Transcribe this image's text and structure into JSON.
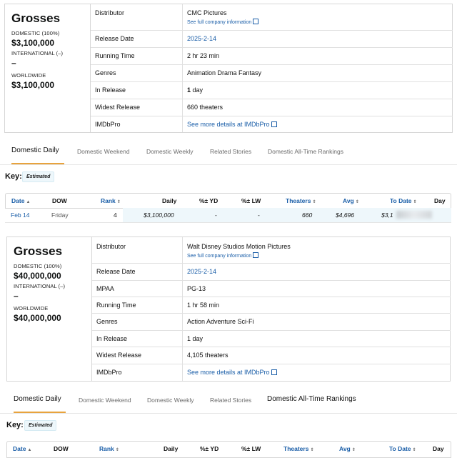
{
  "panel1": {
    "grosses": {
      "title": "Grosses",
      "domestic_label": "DOMESTIC (100%)",
      "domestic_value": "$3,100,000",
      "international_label": "INTERNATIONAL (–)",
      "international_value": "–",
      "worldwide_label": "WORLDWIDE",
      "worldwide_value": "$3,100,000"
    },
    "details": [
      {
        "label": "Distributor",
        "value": "CMC Pictures",
        "sub": "See full company information"
      },
      {
        "label": "Release Date",
        "value": "2025-2-14",
        "link": true
      },
      {
        "label": "Running Time",
        "value": "2 hr 23 min"
      },
      {
        "label": "Genres",
        "value": "Animation Drama Fantasy"
      },
      {
        "label": "In Release",
        "value_bold": "1",
        "value": " day"
      },
      {
        "label": "Widest Release",
        "value": "660 theaters"
      },
      {
        "label": "IMDbPro",
        "value": "See more details at IMDbPro",
        "link": true
      }
    ],
    "tabs": [
      "Domestic Daily",
      "Domestic Weekend",
      "Domestic Weekly",
      "Related Stories",
      "Domestic All-Time Rankings"
    ],
    "key_label": "Key:",
    "key_badge": "Estimated",
    "columns": [
      "Date",
      "DOW",
      "Rank",
      "Daily",
      "%± YD",
      "%± LW",
      "Theaters",
      "Avg",
      "To Date",
      "Day"
    ],
    "row": {
      "date": "Feb 14",
      "dow": "Friday",
      "rank": "4",
      "daily": "$3,100,000",
      "yd": "-",
      "lw": "-",
      "theaters": "660",
      "avg": "$4,696",
      "to_date": "$3,1"
    }
  },
  "panel2": {
    "grosses": {
      "title": "Grosses",
      "domestic_label": "DOMESTIC (100%)",
      "domestic_value": "$40,000,000",
      "international_label": "INTERNATIONAL (–)",
      "international_value": "–",
      "worldwide_label": "WORLDWIDE",
      "worldwide_value": "$40,000,000"
    },
    "details": [
      {
        "label": "Distributor",
        "value": "Walt Disney Studios Motion Pictures",
        "sub": "See full company information"
      },
      {
        "label": "Release Date",
        "value": "2025-2-14",
        "link": true
      },
      {
        "label": "MPAA",
        "value": "PG-13"
      },
      {
        "label": "Running Time",
        "value": "1 hr 58 min"
      },
      {
        "label": "Genres",
        "value": "Action Adventure Sci-Fi"
      },
      {
        "label": "In Release",
        "value": "1 day"
      },
      {
        "label": "Widest Release",
        "value": "4,105 theaters"
      },
      {
        "label": "IMDbPro",
        "value": "See more details at IMDbPro",
        "link": true
      }
    ],
    "tabs": [
      "Domestic Daily",
      "Domestic Weekend",
      "Domestic Weekly",
      "Related Stories",
      "Domestic All-Time Rankings"
    ],
    "key_label": "Key:",
    "key_badge": "Estimated",
    "columns": [
      "Date",
      "DOW",
      "Rank",
      "Daily",
      "%± YD",
      "%± LW",
      "Theaters",
      "Avg",
      "To Date",
      "Day"
    ]
  },
  "colors": {
    "link": "#1a5ea8",
    "tab_accent": "#e8a33d",
    "highlight": "#eef7fb"
  }
}
